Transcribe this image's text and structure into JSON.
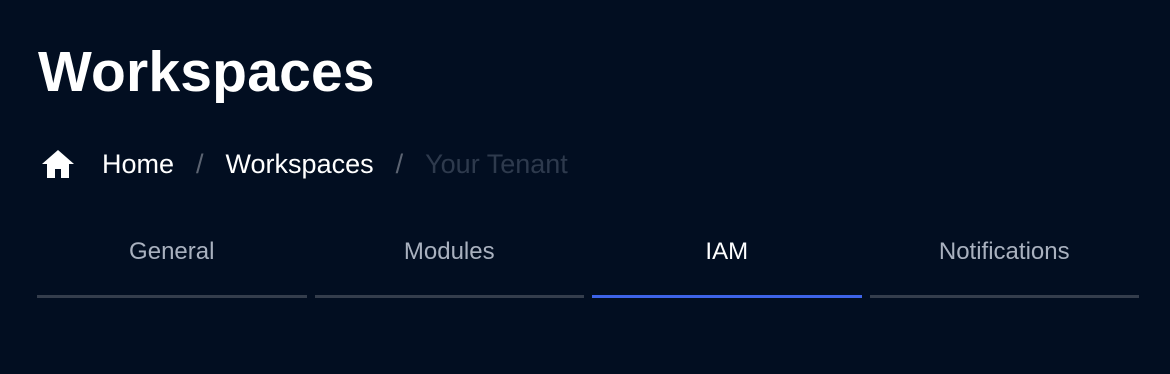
{
  "page": {
    "title": "Workspaces"
  },
  "breadcrumb": {
    "home_icon": "home-icon",
    "items": [
      {
        "label": "Home"
      },
      {
        "label": "Workspaces"
      },
      {
        "label": "Your Tenant"
      }
    ],
    "separator": "/"
  },
  "tabs": [
    {
      "label": "General",
      "active": false
    },
    {
      "label": "Modules",
      "active": false
    },
    {
      "label": "IAM",
      "active": true
    },
    {
      "label": "Notifications",
      "active": false
    }
  ],
  "colors": {
    "background": "#020e21",
    "active_tab_indicator": "#3d63e8",
    "inactive_tab_indicator": "#343d4c",
    "current_crumb": "#2e3a4d"
  }
}
